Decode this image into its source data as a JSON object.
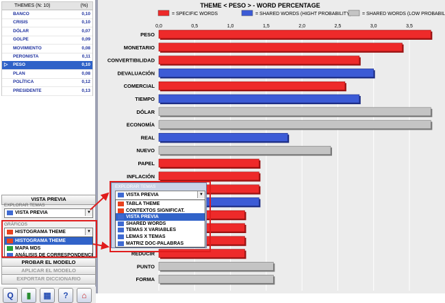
{
  "themes_table": {
    "header_name": "THEMES (N: 10)",
    "header_pct": "(%)",
    "rows": [
      {
        "name": "BANCO",
        "value": "0,10"
      },
      {
        "name": "CRISIS",
        "value": "0,10"
      },
      {
        "name": "DÓLAR",
        "value": "0,07"
      },
      {
        "name": "GOLPE",
        "value": "0,09"
      },
      {
        "name": "MOVIMIENTO",
        "value": "0,08"
      },
      {
        "name": "PERONISTA",
        "value": "0,11"
      },
      {
        "name": "PESO",
        "value": "0,10"
      },
      {
        "name": "PLAN",
        "value": "0,08"
      },
      {
        "name": "POLÍTICA",
        "value": "0,12"
      },
      {
        "name": "PRESIDENTE",
        "value": "0,13"
      }
    ],
    "selected_index": 6,
    "pointer_glyph": "▷"
  },
  "left_panel": {
    "vista_previa_button": "VISTA PREVIA",
    "explorar_label": "EXPLORAR TEMAS",
    "explorar_value": "VISTA PREVIA",
    "graficos_label": "GRÁFICOS",
    "graficos_value": "HISTOGRAMA THEME",
    "graficos_options": [
      {
        "label": "HISTOGRAMA THEME",
        "color": "#e8421e"
      },
      {
        "label": "MAPA MDS",
        "color": "#27a23a"
      },
      {
        "label": "ANÁLISIS DE CORRESPONDENCIAS",
        "color": "#3f6ad2"
      }
    ],
    "probar_button": "PROBAR EL MODELO",
    "aplicar_button": "APLICAR EL MODELO",
    "exportar_button": "EXPORTAR DICCIONARIO"
  },
  "explore_popup": {
    "label": "EXPLORAR TEMAS",
    "value": "VISTA PREVIA",
    "options": [
      {
        "label": "TABLA THEME",
        "color": "#e8421e"
      },
      {
        "label": "CONTEXTOS SIGNIFICAT.",
        "color": "#e8421e"
      },
      {
        "label": "VISTA PREVIA",
        "color": "#3f6ad2"
      },
      {
        "label": "SHARED WORDS",
        "color": "#3f6ad2"
      },
      {
        "label": "TEMAS X VARIABLES",
        "color": "#3f6ad2"
      },
      {
        "label": "LEMAS X TEMAS",
        "color": "#3f6ad2"
      },
      {
        "label": "MATRIZ DOC-PALABRAS",
        "color": "#3f6ad2"
      }
    ],
    "selected_index": 2
  },
  "toolbar": {
    "icons": [
      "quit-icon",
      "bar-chart-icon",
      "grid-icon",
      "help-icon",
      "home-icon"
    ],
    "glyphs": [
      "Q",
      "▮",
      "▦",
      "?",
      "⌂"
    ]
  },
  "chart_data": {
    "type": "bar",
    "orientation": "horizontal",
    "title": "THEME < PESO > - WORD PERCENTAGE",
    "legend": [
      {
        "label": "= SPECIFIC WORDS",
        "color": "#ee2a2a"
      },
      {
        "label": "= SHARED WORDS (HIGHT PROBABILITY)",
        "color": "#3c5bd6"
      },
      {
        "label": "= SHARED WORDS (LOW PROBABILITY)",
        "color": "#c4c4c4"
      }
    ],
    "xlim": [
      0,
      3.5
    ],
    "x_ticks": [
      "0,0",
      "0,5",
      "1,0",
      "1,5",
      "2,0",
      "2,5",
      "3,0",
      "3,5"
    ],
    "categories": [
      "PESO",
      "MONETARIO",
      "CONVERTIBILIDAD",
      "DEVALUACIÓN",
      "COMERCIAL",
      "TIEMPO",
      "DÓLAR",
      "ECONOMÍA",
      "REAL",
      "NUEVO",
      "PAPEL",
      "INFLACIÓN",
      "",
      "",
      "",
      "",
      "",
      "REDUCIR",
      "PUNTO",
      "FORMA"
    ],
    "values": [
      3.8,
      3.4,
      2.8,
      3.0,
      2.6,
      2.8,
      3.8,
      3.8,
      1.8,
      2.4,
      1.4,
      1.4,
      1.4,
      1.4,
      1.2,
      1.2,
      1.2,
      1.2,
      1.6,
      1.6
    ],
    "groups": [
      "specific",
      "specific",
      "specific",
      "shared_high",
      "specific",
      "shared_high",
      "shared_low",
      "shared_low",
      "shared_high",
      "shared_low",
      "specific",
      "specific",
      "specific",
      "shared_high",
      "specific",
      "specific",
      "specific",
      "specific",
      "shared_low",
      "shared_low"
    ]
  }
}
